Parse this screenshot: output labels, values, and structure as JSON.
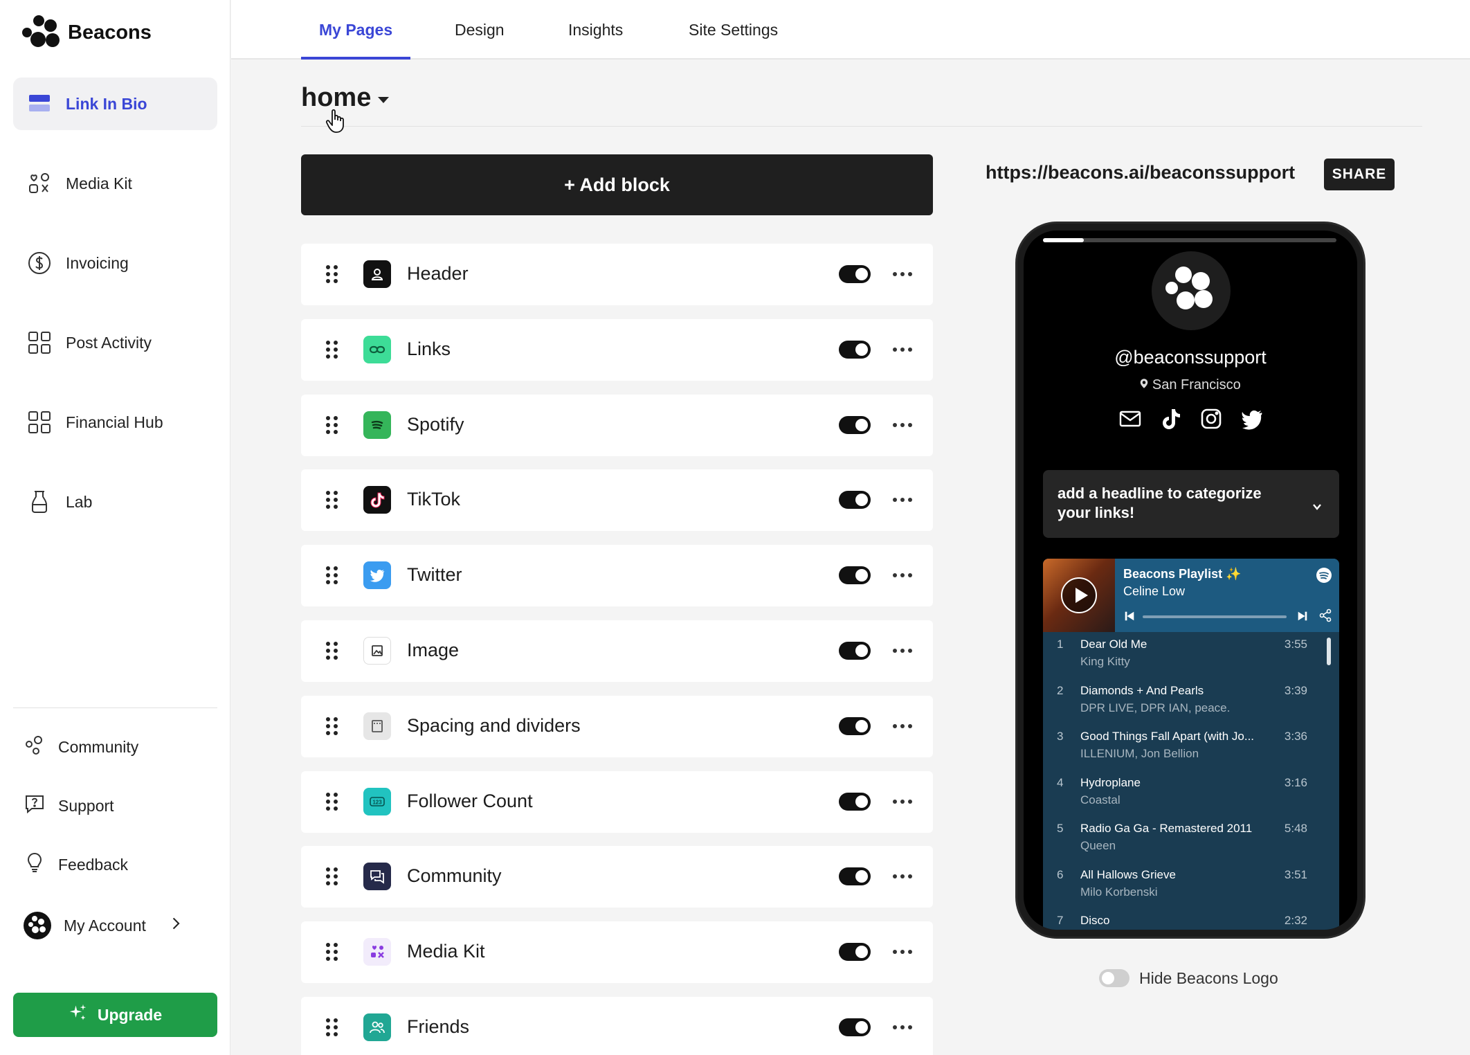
{
  "brand": {
    "name": "Beacons"
  },
  "sidebar": {
    "items": [
      {
        "label": "Link In Bio",
        "icon": "link-in-bio-icon"
      },
      {
        "label": "Media Kit",
        "icon": "media-kit-icon"
      },
      {
        "label": "Invoicing",
        "icon": "dollar-circle-icon"
      },
      {
        "label": "Post Activity",
        "icon": "grid-icon"
      },
      {
        "label": "Financial Hub",
        "icon": "grid-icon"
      },
      {
        "label": "Lab",
        "icon": "flask-icon"
      }
    ],
    "bottom": [
      {
        "label": "Community",
        "icon": "community-icon"
      },
      {
        "label": "Support",
        "icon": "question-bubble-icon"
      },
      {
        "label": "Feedback",
        "icon": "lightbulb-icon"
      },
      {
        "label": "My Account",
        "icon": "avatar"
      }
    ],
    "upgrade_label": "Upgrade"
  },
  "tabs": [
    {
      "label": "My Pages",
      "active": true
    },
    {
      "label": "Design"
    },
    {
      "label": "Insights"
    },
    {
      "label": "Site Settings"
    }
  ],
  "page": {
    "title": "home"
  },
  "add_block_label": "+ Add block",
  "blocks": [
    {
      "label": "Header",
      "icon": "person-icon",
      "enabled": true,
      "color": "#111111"
    },
    {
      "label": "Links",
      "icon": "link-icon",
      "enabled": true,
      "color": "#3ddc97"
    },
    {
      "label": "Spotify",
      "icon": "spotify-icon",
      "enabled": true,
      "color": "#35b55a"
    },
    {
      "label": "TikTok",
      "icon": "tiktok-icon",
      "enabled": true,
      "color": "#111111"
    },
    {
      "label": "Twitter",
      "icon": "twitter-icon",
      "enabled": true,
      "color": "#3b9cf0"
    },
    {
      "label": "Image",
      "icon": "image-icon",
      "enabled": true,
      "color": "#ffffff"
    },
    {
      "label": "Spacing and dividers",
      "icon": "divider-icon",
      "enabled": true,
      "color": "#e6e6e6"
    },
    {
      "label": "Follower Count",
      "icon": "counter-icon",
      "enabled": true,
      "color": "#21c3c0"
    },
    {
      "label": "Community",
      "icon": "chat-icon",
      "enabled": true,
      "color": "#262a4a"
    },
    {
      "label": "Media Kit",
      "icon": "media-kit-icon",
      "enabled": true,
      "color": "#f2ecfb"
    },
    {
      "label": "Friends",
      "icon": "friends-icon",
      "enabled": true,
      "color": "#21a794"
    }
  ],
  "preview": {
    "url": "https://beacons.ai/beaconssupport",
    "share_label": "SHARE",
    "handle": "@beaconssupport",
    "location": "San Francisco",
    "socials": [
      "mail-icon",
      "tiktok-icon",
      "instagram-icon",
      "twitter-icon"
    ],
    "story_progress": 0.14,
    "headline": "add a headline to categorize your links!",
    "spotify": {
      "playlist": "Beacons Playlist ✨",
      "artist": "Celine Low",
      "tracks": [
        {
          "n": "1",
          "name": "Dear Old Me",
          "artist": "King Kitty",
          "dur": "3:55"
        },
        {
          "n": "2",
          "name": "Diamonds + And Pearls",
          "artist": "DPR LIVE, DPR IAN, peace.",
          "dur": "3:39"
        },
        {
          "n": "3",
          "name": "Good Things Fall Apart (with Jo...",
          "artist": "ILLENIUM, Jon Bellion",
          "dur": "3:36"
        },
        {
          "n": "4",
          "name": "Hydroplane",
          "artist": "Coastal",
          "dur": "3:16"
        },
        {
          "n": "5",
          "name": "Radio Ga Ga - Remastered 2011",
          "artist": "Queen",
          "dur": "5:48"
        },
        {
          "n": "6",
          "name": "All Hallows Grieve",
          "artist": "Milo Korbenski",
          "dur": "3:51"
        },
        {
          "n": "7",
          "name": "Disco",
          "artist": "",
          "dur": "2:32"
        }
      ]
    },
    "hide_logo_label": "Hide Beacons Logo",
    "hide_logo_enabled": false
  },
  "colors": {
    "accent": "#3a46d6",
    "upgrade": "#1f9d48",
    "dark": "#1f1f1f"
  }
}
